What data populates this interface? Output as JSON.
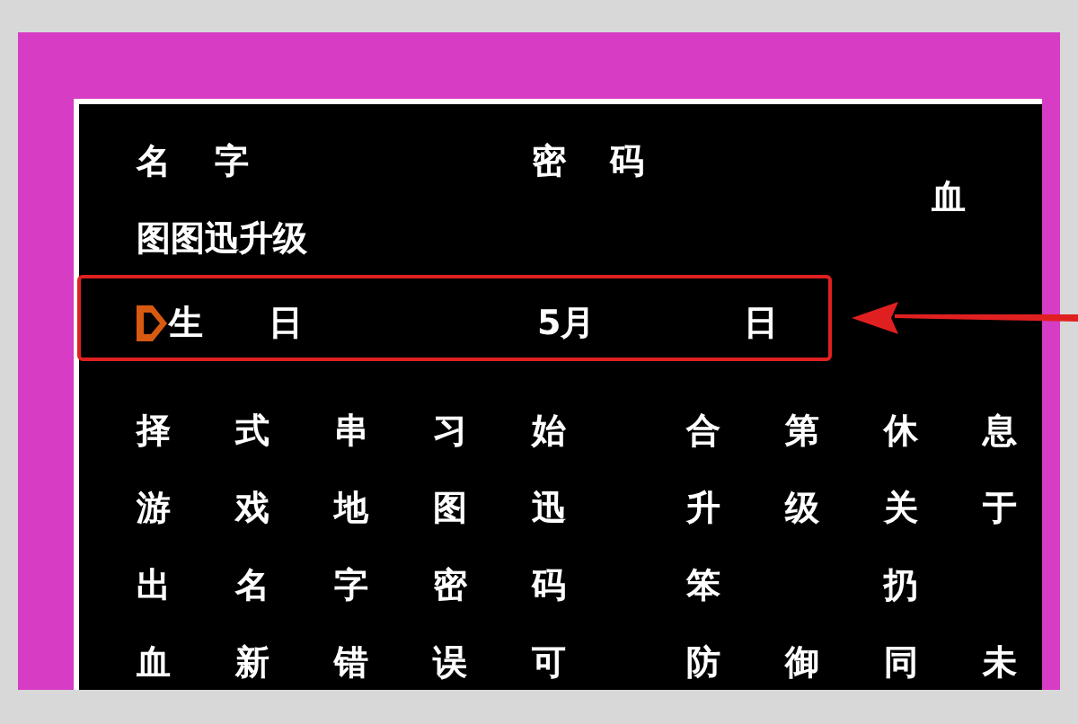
{
  "header": {
    "name_label": "名 字",
    "password_label": "密 码",
    "blood_label": "血"
  },
  "status_line": "图图迅升级",
  "birthday_row": {
    "label": "生 日",
    "month": "5月",
    "day_label": "日",
    "cursor": true
  },
  "char_grid": [
    {
      "left": [
        "择",
        "式",
        "串",
        "习",
        "始"
      ],
      "right": [
        "合",
        "第",
        "休",
        "息"
      ]
    },
    {
      "left": [
        "游",
        "戏",
        "地",
        "图",
        "迅"
      ],
      "right": [
        "升",
        "级",
        "关",
        "于"
      ]
    },
    {
      "left": [
        "出",
        "名",
        "字",
        "密",
        "码"
      ],
      "right": [
        "笨",
        {
          "kind": "blank"
        },
        "扔",
        {
          "kind": "blank"
        }
      ]
    },
    {
      "left": [
        "血",
        "新",
        "错",
        "误",
        "可"
      ],
      "right": [
        "防",
        "御",
        "同",
        "未"
      ]
    }
  ],
  "annotation": {
    "highlight_box": true,
    "arrow": true
  }
}
